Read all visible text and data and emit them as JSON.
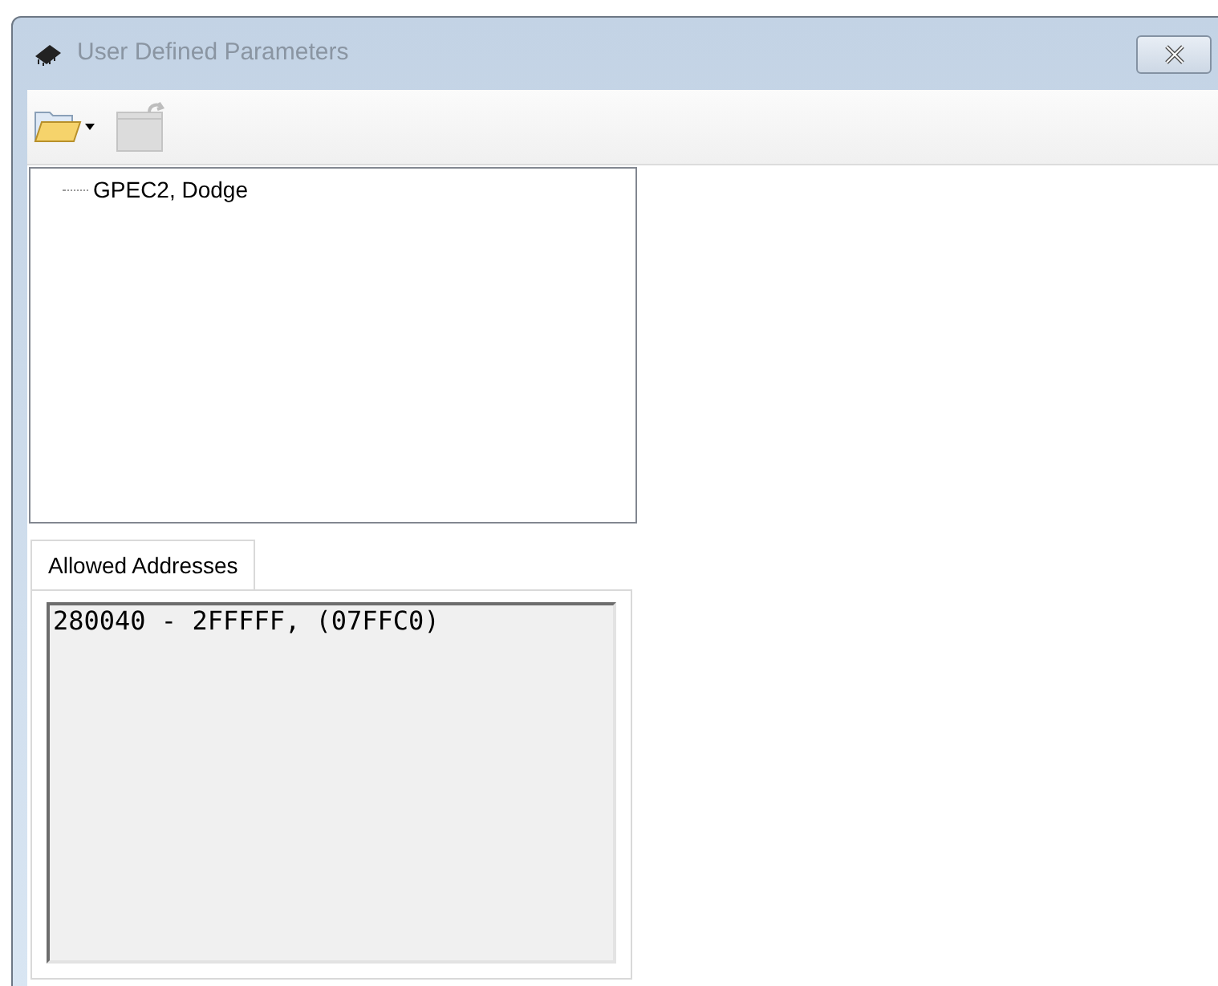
{
  "window": {
    "title": "User Defined Parameters"
  },
  "toolbar": [
    {
      "kind": "open",
      "disabled": false
    },
    {
      "kind": "revert",
      "disabled": true
    }
  ],
  "tree": [
    {
      "label": "GPEC2, Dodge",
      "selected": false
    }
  ],
  "tabs": [
    {
      "label": "Allowed Addresses",
      "selected": true
    }
  ],
  "addresses": {
    "value": "280040 - 2FFFFF, (07FFC0)"
  }
}
